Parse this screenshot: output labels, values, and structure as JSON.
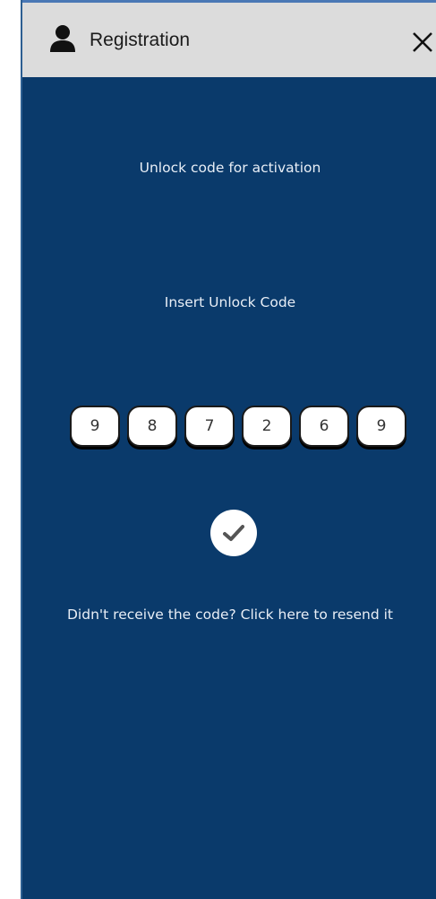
{
  "header": {
    "title": "Registration",
    "user_icon": "user-icon",
    "close_icon": "close-icon"
  },
  "main": {
    "subtitle": "Unlock code for activation",
    "prompt": "Insert Unlock Code",
    "code_digits": [
      "9",
      "8",
      "7",
      "2",
      "6",
      "9"
    ],
    "confirm_icon": "checkmark-icon",
    "resend_link": "Didn't receive the code? Click here to resend it"
  },
  "colors": {
    "background": "#0a3a6b",
    "header_background": "#dcdcdc",
    "text": "#e8eef6"
  }
}
